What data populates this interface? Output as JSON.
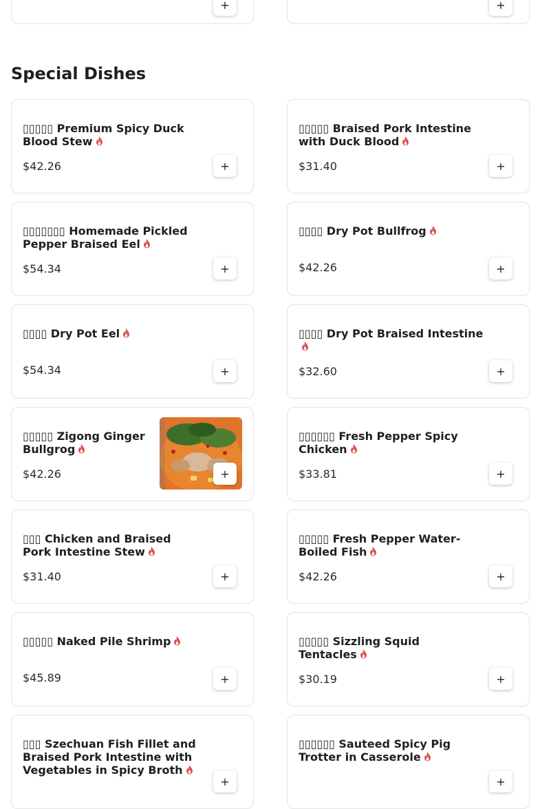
{
  "section_title": "Special Dishes",
  "add_label": "+",
  "dishes": [
    {
      "name": "▯▯▯▯▯ Premium Spicy Duck Blood Stew",
      "price": "$42.26"
    },
    {
      "name": "▯▯▯▯▯ Braised Pork Intestine with Duck Blood",
      "price": "$31.40"
    },
    {
      "name": "▯▯▯▯▯▯▯ Homemade Pickled Pepper Braised Eel",
      "price": "$54.34"
    },
    {
      "name": "▯▯▯▯ Dry Pot Bullfrog",
      "price": "$42.26"
    },
    {
      "name": "▯▯▯▯ Dry Pot Eel",
      "price": "$54.34"
    },
    {
      "name": "▯▯▯▯ Dry Pot Braised Intestine",
      "price": "$32.60"
    },
    {
      "name": "▯▯▯▯▯ Zigong Ginger Bullgrog",
      "price": "$42.26"
    },
    {
      "name": "▯▯▯▯▯▯ Fresh Pepper Spicy Chicken",
      "price": "$33.81"
    },
    {
      "name": "▯▯▯ Chicken and Braised Pork Intestine Stew",
      "price": "$31.40"
    },
    {
      "name": "▯▯▯▯▯ Fresh Pepper Water-Boiled Fish",
      "price": "$42.26"
    },
    {
      "name": "▯▯▯▯▯ Naked Pile Shrimp",
      "price": "$45.89"
    },
    {
      "name": "▯▯▯▯▯ Sizzling Squid Tentacles",
      "price": "$30.19"
    },
    {
      "name": "▯▯▯ Szechuan Fish Fillet and Braised Pork Intestine with Vegetables in Spicy Broth",
      "price": ""
    },
    {
      "name": "▯▯▯▯▯▯ Sauteed Spicy Pig Trotter in Casserole",
      "price": ""
    }
  ],
  "colors": {
    "flame": "#d9534f",
    "border": "#e3e3e3"
  },
  "icons": {
    "spicy": "flame-icon",
    "add": "plus-icon"
  }
}
